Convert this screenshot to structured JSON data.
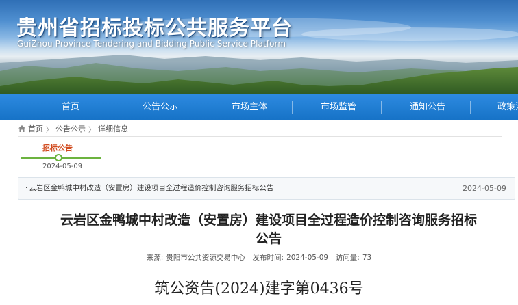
{
  "header": {
    "title_cn": "贵州省招标投标公共服务平台",
    "title_en": "GuiZhou Province Tendering and Bidding Public Service Platform"
  },
  "nav": {
    "items": [
      {
        "label": "首页"
      },
      {
        "label": "公告公示"
      },
      {
        "label": "市场主体"
      },
      {
        "label": "市场监管"
      },
      {
        "label": "通知公告"
      },
      {
        "label": "政策法"
      }
    ]
  },
  "breadcrumb": {
    "items": [
      "首页",
      "公告公示",
      "详细信息"
    ],
    "separator": "〉"
  },
  "timeline": {
    "label": "招标公告",
    "date": "2024-05-09"
  },
  "notice": {
    "bullet": "·",
    "title": "云岩区金鸭城中村改造（安置房）建设项目全过程造价控制咨询服务招标公告",
    "date": "2024-05-09"
  },
  "article": {
    "title_line1": "云岩区金鸭城中村改造（安置房）建设项目全过程造价控制咨询服务招标",
    "title_line2": "公告",
    "source_label": "来源:",
    "source": "贵阳市公共资源交易中心",
    "publish_label": "发布时间:",
    "publish_time": "2024-05-09",
    "views_label": "访问量:",
    "views": "73",
    "doc_number": "筑公资告(2024)建字第0436号"
  },
  "colors": {
    "nav_bg": "#1672c6",
    "accent_orange": "#d14b1f",
    "timeline_green": "#6cb33f"
  }
}
